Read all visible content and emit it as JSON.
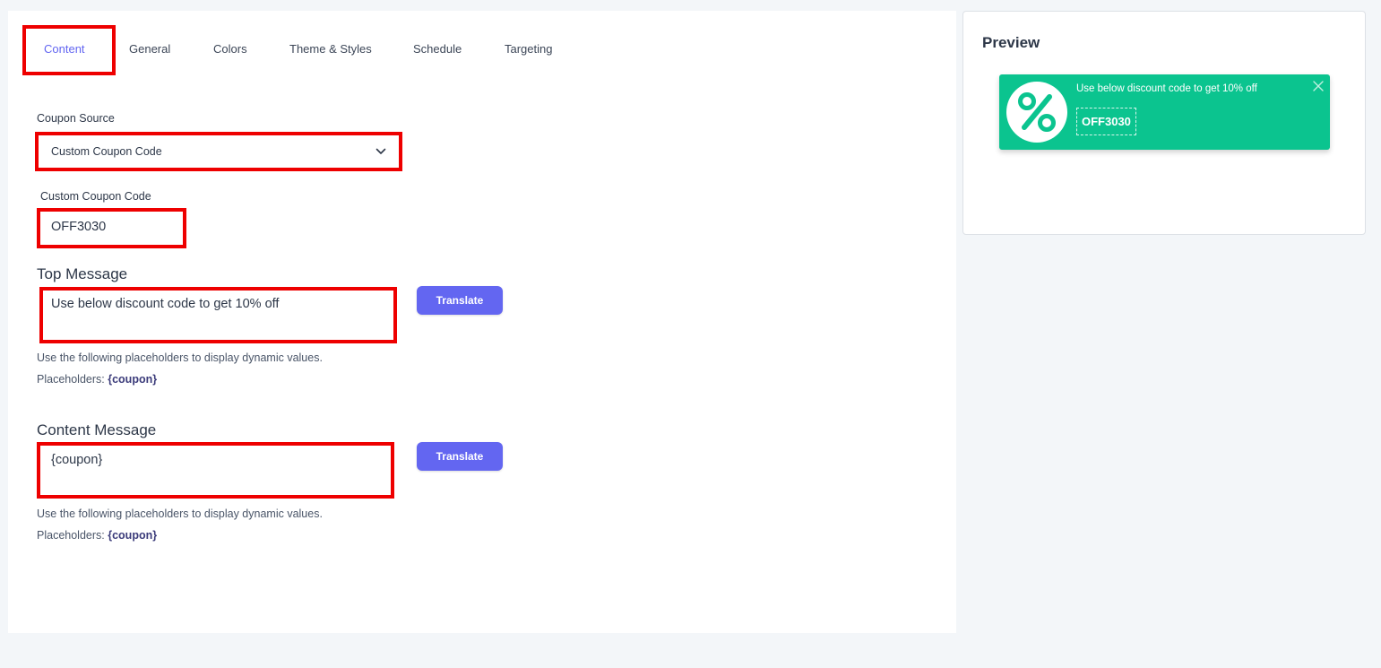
{
  "tabs": [
    {
      "label": "Content",
      "active": true
    },
    {
      "label": "General"
    },
    {
      "label": "Colors"
    },
    {
      "label": "Theme & Styles"
    },
    {
      "label": "Schedule"
    },
    {
      "label": "Targeting"
    }
  ],
  "coupon_source": {
    "label": "Coupon Source",
    "selected": "Custom Coupon Code"
  },
  "custom_coupon": {
    "label": "Custom Coupon Code",
    "value": "OFF3030"
  },
  "top_message": {
    "title": "Top Message",
    "value": "Use below discount code to get 10% off",
    "translate_label": "Translate",
    "help": "Use the following placeholders to display dynamic values.",
    "placeholders_label": "Placeholders:",
    "placeholders_value": "{coupon}"
  },
  "content_message": {
    "title": "Content Message",
    "value": "{coupon}",
    "translate_label": "Translate",
    "help": "Use the following placeholders to display dynamic values.",
    "placeholders_label": "Placeholders:",
    "placeholders_value": "{coupon}"
  },
  "preview": {
    "title": "Preview",
    "message": "Use below discount code to get 10% off",
    "code": "OFF3030",
    "icon": "percent-icon"
  },
  "colors": {
    "accent": "#6366f1",
    "coupon_bg": "#0bc48f",
    "highlight": "#ee0000"
  }
}
